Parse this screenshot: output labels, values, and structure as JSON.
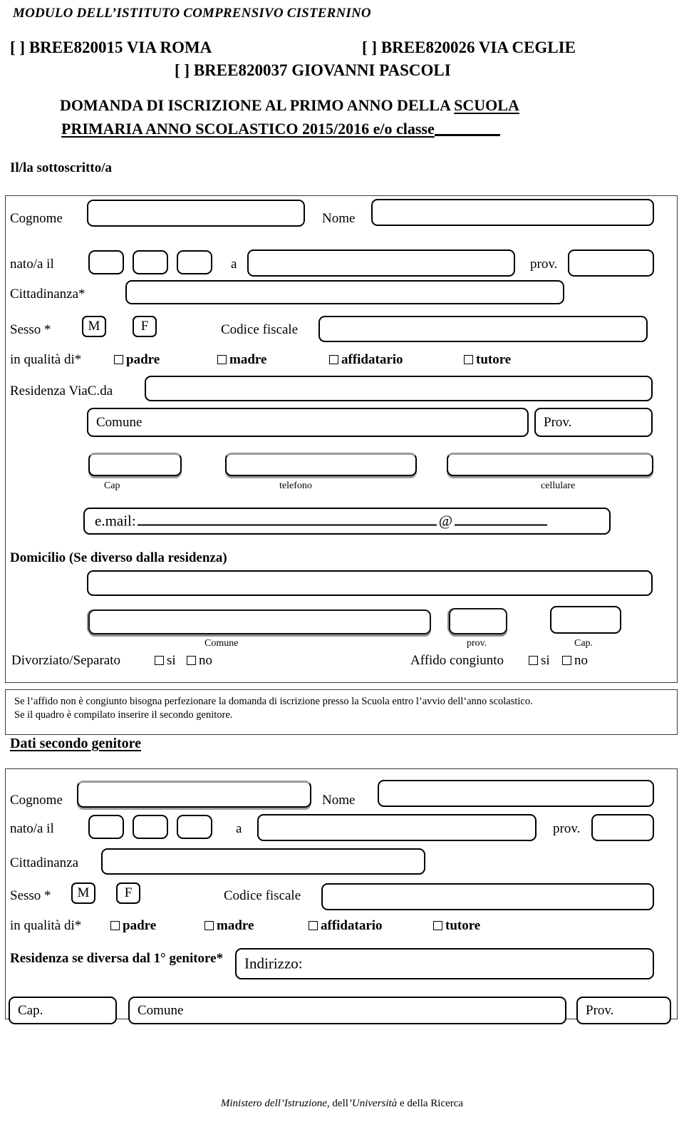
{
  "header": {
    "institute_title": "MODULO DELL’ISTITUTO COMPRENSIVO CISTERNINO",
    "schools": [
      {
        "checkbox": "[   ]",
        "code": "BREE820015",
        "name": "VIA ROMA"
      },
      {
        "checkbox": "[   ]",
        "code": "BREE820026",
        "name": "VIA CEGLIE"
      },
      {
        "checkbox": "[   ]",
        "code": "BREE820037",
        "name": "GIOVANNI PASCOLI"
      }
    ],
    "request_line_1_plain": "DOMANDA DI ISCRIZIONE  AL PRIMO ANNO DELLA ",
    "request_line_1_underlined": "SCUOLA",
    "request_line_2_underlined": "PRIMARIA ANNO SCOLASTICO 2015/2016  e/o classe"
  },
  "subscriber": {
    "heading": "Il/la  sottoscritto/a",
    "cognome_label": "Cognome",
    "nome_label": "Nome",
    "nato_label": "nato/a il",
    "a_label": "a",
    "prov_label": "prov.",
    "cittadinanza_label": "Cittadinanza*",
    "sesso_label": "Sesso *",
    "sesso_m": "M",
    "sesso_f": "F",
    "codice_fiscale_label": "Codice fiscale",
    "qualita_label": "in qualità di*",
    "qualita_options": [
      "padre",
      "madre",
      "affidatario",
      "tutore"
    ],
    "residenza_label": "Residenza  ViaC.da",
    "comune_label": "Comune",
    "prov_box_label": "Prov.",
    "cap_caption": "Cap",
    "telefono_caption": "telefono",
    "cellulare_caption": "cellulare",
    "email_label": "e.mail:",
    "email_at": "@"
  },
  "domicile": {
    "heading": "Domicilio (Se diverso dalla residenza)",
    "comune_caption": "Comune",
    "prov_caption": "prov.",
    "cap_caption": "Cap.",
    "divorziato_label": "Divorziato/Separato",
    "divorziato_si": "si",
    "divorziato_no": "no",
    "affido_label": "Affido congiunto",
    "affido_si": "si",
    "affido_no": "no"
  },
  "note": {
    "line_1": "Se l’affido non è congiunto bisogna perfezionare la domanda di iscrizione presso la Scuola entro l’avvio dell’anno scolastico.",
    "line_2": "Se il quadro è compilato inserire il secondo genitore."
  },
  "second_parent": {
    "heading": "Dati secondo genitore",
    "cognome_label": "Cognome",
    "nome_label": "Nome",
    "nato_label": "nato/a il",
    "a_label": "a",
    "prov_label": "prov.",
    "cittadinanza_label": "Cittadinanza",
    "sesso_label": "Sesso *",
    "sesso_m": "M",
    "sesso_f": "F",
    "codice_fiscale_label": "Codice fiscale",
    "qualita_label": "in qualità di*",
    "qualita_options": [
      "padre",
      "madre",
      "affidatario",
      "tutore"
    ],
    "residenza_label": "Residenza se diversa dal 1° genitore*",
    "indirizzo_label": "Indirizzo:",
    "cap_label": "Cap.",
    "comune_label": "Comune",
    "prov_box_label": "Prov."
  },
  "footer": {
    "ministry_italic_1": "Ministero dell’Istruzione",
    "ministry_plain_1": ", dell",
    "ministry_italic_2": "’Università",
    "ministry_plain_2": " e  della Ricerca"
  }
}
